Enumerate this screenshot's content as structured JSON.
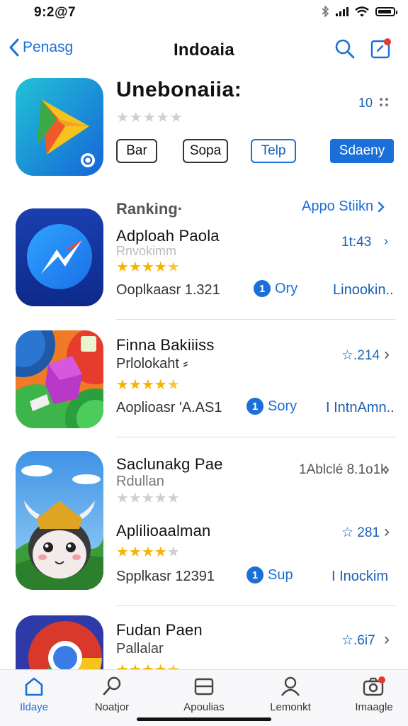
{
  "status": {
    "time": "9:2@7"
  },
  "nav": {
    "back_label": "Penasg",
    "title": "Indoaia"
  },
  "featured": {
    "name": "Unebonaiia:",
    "count": "10",
    "rating_stars": 0,
    "chips": [
      "Bar",
      "Sopa",
      "Telp",
      "Sdaeny"
    ]
  },
  "section": {
    "title": "Ranking·",
    "link": "Appo Stiikn"
  },
  "apps": [
    {
      "name": "Adploah Paola",
      "subtitle": "Rnvokimm",
      "rating_stars": 4.5,
      "meta": "Ooplkaasr   1.321",
      "get_number": "1",
      "get_label": "Ory",
      "action": "Linookin..",
      "right_value": "1t:43",
      "right_chevron": "›",
      "icon": "messenger-app-icon"
    },
    {
      "name": "Finna Bakiiiss",
      "subtitle": "Prlolokaht ⸗",
      "rating_stars": 4.5,
      "meta": "Aoplioasr  'A.AS1",
      "get_number": "1",
      "get_label": "Sory",
      "action": "I IntnAmn..",
      "right_value": "☆.214",
      "right_chevron": "›",
      "icon": "puzzle-game-icon"
    },
    {
      "name": "Saclunakg Pae",
      "subtitle": "Rdullan",
      "rating_stars": 0,
      "meta": "",
      "get_number": "",
      "get_label": "",
      "action": "",
      "right_value": "1Ablclé 8.1o1k",
      "right_chevron": "›",
      "icon": "viking-cow-game-icon"
    },
    {
      "name": "Aplilioaalman",
      "subtitle": "",
      "rating_stars": 4.0,
      "meta": "Spplkasr  12391",
      "get_number": "1",
      "get_label": "Sup",
      "action": "I Inockim",
      "right_value": "☆ 281",
      "right_chevron": "›",
      "icon": ""
    },
    {
      "name": "Fudan Paen",
      "subtitle": "Pallalar",
      "rating_stars": 4.5,
      "meta": "",
      "get_number": "",
      "get_label": "",
      "action": "",
      "right_value": "☆.6i7",
      "right_chevron": "›",
      "icon": "chrome-browser-icon"
    }
  ],
  "tabs": [
    {
      "label": "Ildaye",
      "icon": "home-icon",
      "active": true
    },
    {
      "label": "Noatjor",
      "icon": "search-icon",
      "active": false
    },
    {
      "label": "Apoulias",
      "icon": "apps-icon",
      "active": false
    },
    {
      "label": "Lemonkt",
      "icon": "person-icon",
      "active": false
    },
    {
      "label": "Imaagle",
      "icon": "camera-icon",
      "active": false
    }
  ],
  "colors": {
    "accent": "#1a6fd8",
    "star": "#f5b400",
    "badge": "#e53935"
  }
}
